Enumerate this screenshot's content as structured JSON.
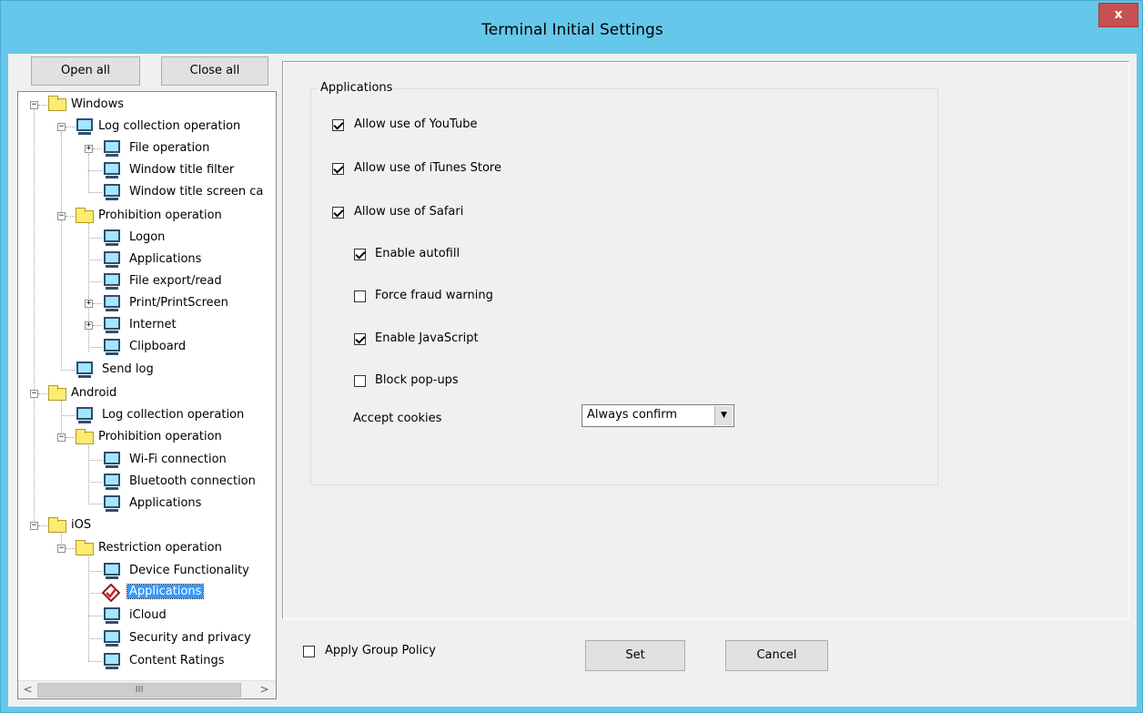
{
  "window": {
    "title": "Terminal Initial Settings",
    "close_label": "x"
  },
  "tree_buttons": {
    "open_all": "Open all",
    "close_all": "Close all"
  },
  "tree": {
    "windows": "Windows",
    "win_log_collection": "Log collection operation",
    "win_file_operation": "File operation",
    "win_window_title_filter": "Window title filter",
    "win_window_title_screen": "Window title screen ca",
    "win_prohibition": "Prohibition operation",
    "win_logon": "Logon",
    "win_applications": "Applications",
    "win_file_export": "File export/read",
    "win_print": "Print/PrintScreen",
    "win_internet": "Internet",
    "win_clipboard": "Clipboard",
    "win_send_log": "Send log",
    "android": "Android",
    "and_log_collection": "Log collection operation",
    "and_prohibition": "Prohibition operation",
    "and_wifi": "Wi-Fi connection",
    "and_bluetooth": "Bluetooth connection",
    "and_applications": "Applications",
    "ios": "iOS",
    "ios_restriction": "Restriction operation",
    "ios_device_functionality": "Device Functionality",
    "ios_applications": "Applications",
    "ios_icloud": "iCloud",
    "ios_security": "Security and privacy",
    "ios_content_ratings": "Content Ratings"
  },
  "scrollbar": {
    "left": "<",
    "thumb": "III",
    "right": ">"
  },
  "applications": {
    "legend": "Applications",
    "youtube": {
      "label": "Allow use of YouTube",
      "checked": true
    },
    "itunes": {
      "label": "Allow use of iTunes Store",
      "checked": true
    },
    "safari": {
      "label": "Allow use of Safari",
      "checked": true
    },
    "autofill": {
      "label": "Enable autofill",
      "checked": true
    },
    "fraud": {
      "label": "Force fraud warning",
      "checked": false
    },
    "javascript": {
      "label": "Enable JavaScript",
      "checked": true
    },
    "popups": {
      "label": "Block pop-ups",
      "checked": false
    },
    "cookies_label": "Accept cookies",
    "cookies_value": "Always confirm"
  },
  "footer": {
    "apply_group_policy": "Apply Group Policy",
    "apply_group_policy_checked": false,
    "set": "Set",
    "cancel": "Cancel"
  },
  "colors": {
    "titlebar": "#65c8ea",
    "close": "#c75050",
    "selection": "#3399ff",
    "folder": "#ffeb6f"
  }
}
